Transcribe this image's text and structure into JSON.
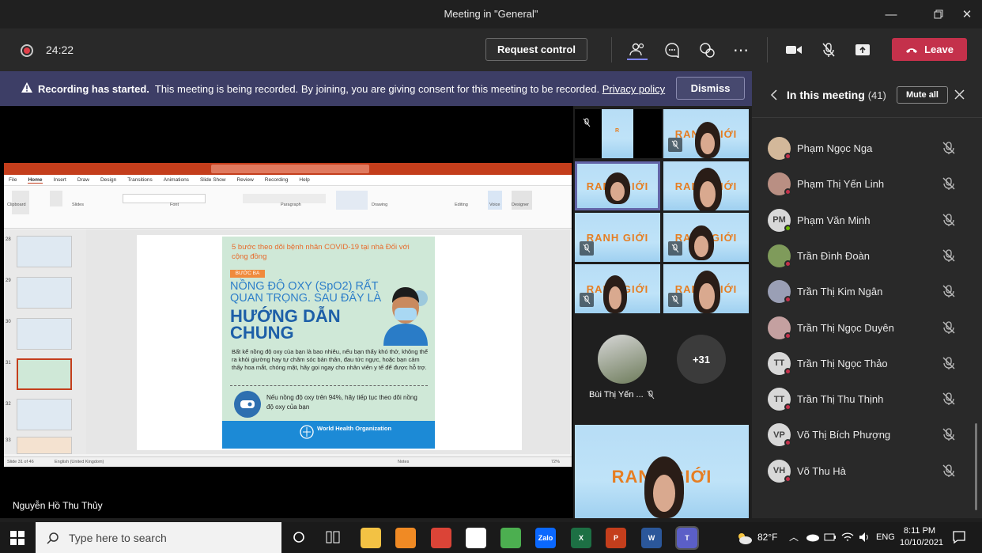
{
  "window": {
    "title": "Meeting in \"General\""
  },
  "toolbar": {
    "timer": "24:22",
    "request_control": "Request control",
    "leave": "Leave"
  },
  "banner": {
    "title": "Recording has started.",
    "message": "This meeting is being recorded. By joining, you are giving consent for this meeting to be recorded.",
    "link": "Privacy policy",
    "dismiss": "Dismiss"
  },
  "stage": {
    "presenter_name": "Nguyễn Hồ Thu Thủy",
    "ppt": {
      "tabs": [
        "File",
        "Home",
        "Insert",
        "Draw",
        "Design",
        "Transitions",
        "Animations",
        "Slide Show",
        "Review",
        "Recording",
        "Help"
      ],
      "groups": [
        "Clipboard",
        "Slides",
        "Font",
        "Paragraph",
        "Drawing",
        "Editing",
        "Voice",
        "Designer"
      ],
      "thumb_numbers": [
        "28",
        "29",
        "30",
        "31",
        "32",
        "33"
      ],
      "status_left": "Slide 31 of 46",
      "status_lang": "English (United Kingdom)",
      "status_notes": "Notes",
      "zoom": "72%"
    },
    "slide": {
      "heading": "5 bước theo dõi bệnh nhân COVID-19 tại nhà Đối với cộng đồng",
      "step": "BƯỚC BA",
      "big1": "NỒNG ĐỘ OXY (SpO2) RẤT QUAN TRỌNG. SAU ĐÂY LÀ",
      "big2": "HƯỚNG DẪN CHUNG",
      "body": "Bất kể nồng độ oxy của bạn là bao nhiêu, nếu bạn thấy khó thở, không thể ra khỏi giường hay tự chăm sóc bản thân, đau tức ngực, hoặc bạn cảm thấy hoa mắt, chóng mặt, hãy gọi ngay cho nhân viên y tế để được hỗ trợ.",
      "tip": "Nếu nồng độ oxy trên 94%, hãy tiếp tục theo dõi nồng độ oxy của bạn",
      "org": "World Health Organization"
    }
  },
  "gallery": {
    "tile_text": "RANH GIỚI",
    "audio_participant": "Bùi Thị Yến ...",
    "overflow_count": "+31"
  },
  "panel": {
    "title": "In this meeting",
    "count": "(41)",
    "mute_all": "Mute all",
    "participants": [
      {
        "name": "Phạm Ngọc Nga",
        "initials": "",
        "status": "busy"
      },
      {
        "name": "Phạm Thị Yến Linh",
        "initials": "",
        "status": "busy"
      },
      {
        "name": "Phạm Văn Minh",
        "initials": "PM",
        "status": "available"
      },
      {
        "name": "Trần Đình Đoàn",
        "initials": "",
        "status": "busy"
      },
      {
        "name": "Trần Thị Kim Ngân",
        "initials": "",
        "status": "busy"
      },
      {
        "name": "Trần Thị Ngọc Duyên",
        "initials": "",
        "status": "busy"
      },
      {
        "name": "Trần Thị Ngọc Thảo",
        "initials": "TT",
        "status": "busy"
      },
      {
        "name": "Trần Thị Thu Thịnh",
        "initials": "TT",
        "status": "busy"
      },
      {
        "name": "Võ Thị Bích Phượng",
        "initials": "VP",
        "status": "busy"
      },
      {
        "name": "Võ Thu Hà",
        "initials": "VH",
        "status": "busy"
      }
    ]
  },
  "taskbar": {
    "search_placeholder": "Type here to search",
    "weather": "82°F",
    "lang": "ENG",
    "time": "8:11 PM",
    "date": "10/10/2021",
    "apps": [
      {
        "label": "",
        "color": "#f3c244"
      },
      {
        "label": "",
        "color": "#f08a24"
      },
      {
        "label": "",
        "color": "#db4437"
      },
      {
        "label": "",
        "color": "#ffffff"
      },
      {
        "label": "",
        "color": "#4caf50"
      },
      {
        "label": "Zalo",
        "color": "#0a68ff"
      },
      {
        "label": "X",
        "color": "#1d7044"
      },
      {
        "label": "P",
        "color": "#c43e1c"
      },
      {
        "label": "W",
        "color": "#2b579a"
      },
      {
        "label": "T",
        "color": "#5b5fc7"
      }
    ]
  }
}
